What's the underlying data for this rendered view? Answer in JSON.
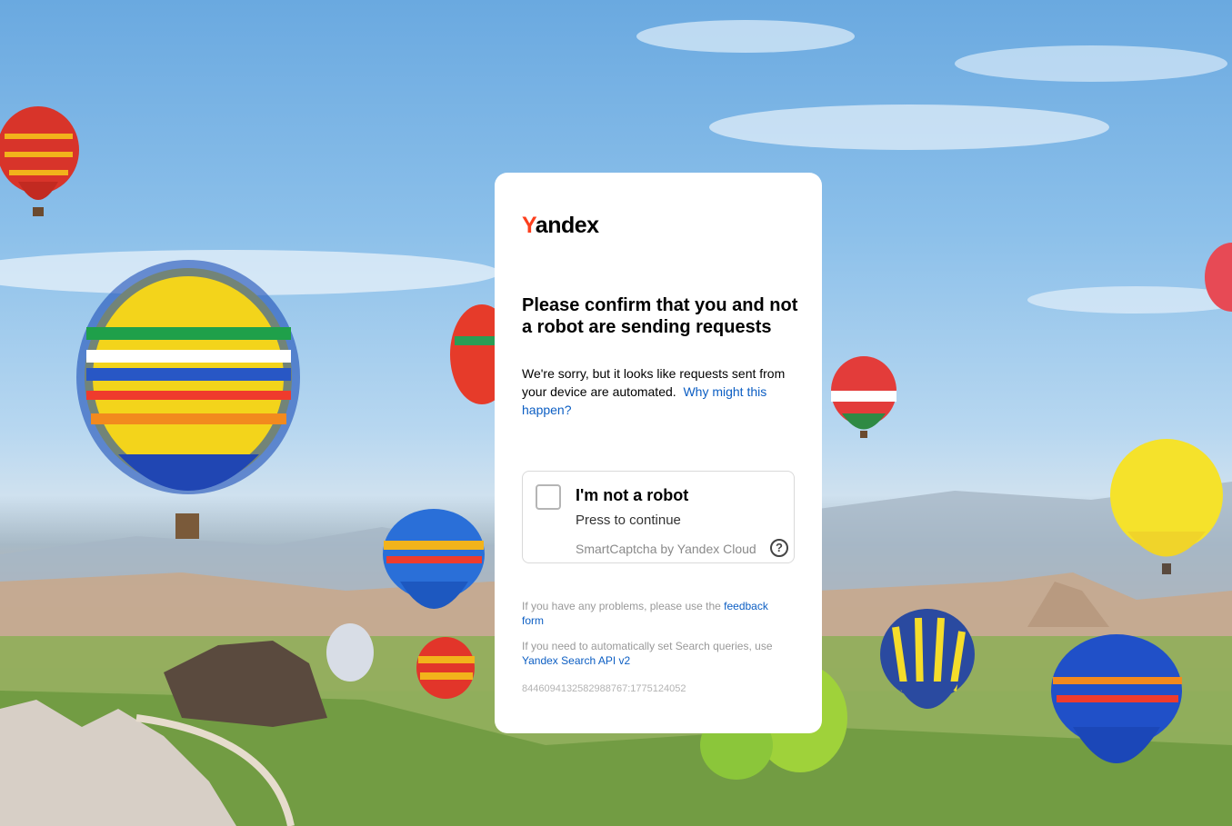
{
  "logo": {
    "first_letter": "Y",
    "rest": "andex"
  },
  "title": "Please confirm that you and not a robot are sending requests",
  "description": {
    "text": "We're sorry, but it looks like requests sent from your device are automated.",
    "link_label": "Why might this happen?"
  },
  "captcha": {
    "title": "I'm not a robot",
    "subtitle": "Press to continue",
    "brand": "SmartCaptcha by Yandex Cloud",
    "help_glyph": "?",
    "checked": false
  },
  "footer": {
    "problems_text": "If you have any problems, please use the",
    "problems_link": "feedback form",
    "api_text": "If you need to automatically set Search queries, use",
    "api_link": "Yandex Search API v2",
    "request_id": "8446094132582988767:1775124052"
  },
  "colors": {
    "brand_red": "#fc3f1d",
    "link": "#0c5ec3",
    "muted": "#999999"
  }
}
